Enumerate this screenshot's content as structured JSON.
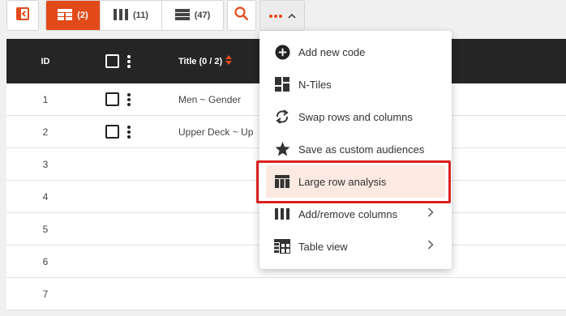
{
  "toolbar": {
    "view_tabs": [
      {
        "count": "(2)",
        "icon": "table-rows-icon",
        "active": true
      },
      {
        "count": "(11)",
        "icon": "columns-icon",
        "active": false
      },
      {
        "count": "(47)",
        "icon": "list-rows-icon",
        "active": false
      }
    ],
    "more_icon": "more-horizontal-icon"
  },
  "accent_color": "#e24a1a",
  "highlight_border_color": "#d9201f",
  "table": {
    "headers": {
      "id": "ID",
      "title": "Title (0 / 2)"
    },
    "rows": [
      {
        "id": "1",
        "title": "Men ~ Gender",
        "has_controls": true
      },
      {
        "id": "2",
        "title": "Upper Deck ~ Up",
        "has_controls": true
      },
      {
        "id": "3",
        "title": "",
        "has_controls": false
      },
      {
        "id": "4",
        "title": "",
        "has_controls": false
      },
      {
        "id": "5",
        "title": "",
        "has_controls": false
      },
      {
        "id": "6",
        "title": "",
        "has_controls": false
      },
      {
        "id": "7",
        "title": "",
        "has_controls": false
      }
    ]
  },
  "menu": {
    "items": [
      {
        "label": "Add new code",
        "icon": "add-circle-icon",
        "submenu": false,
        "highlighted": false
      },
      {
        "label": "N-Tiles",
        "icon": "tiles-icon",
        "submenu": false,
        "highlighted": false
      },
      {
        "label": "Swap rows and columns",
        "icon": "swap-icon",
        "submenu": false,
        "highlighted": false
      },
      {
        "label": "Save as custom audiences",
        "icon": "star-icon",
        "submenu": false,
        "highlighted": false
      },
      {
        "label": "Large row analysis",
        "icon": "table-icon",
        "submenu": false,
        "highlighted": true
      },
      {
        "label": "Add/remove columns",
        "icon": "columns-icon",
        "submenu": true,
        "highlighted": false
      },
      {
        "label": "Table view",
        "icon": "table-view-icon",
        "submenu": true,
        "highlighted": false
      }
    ]
  }
}
